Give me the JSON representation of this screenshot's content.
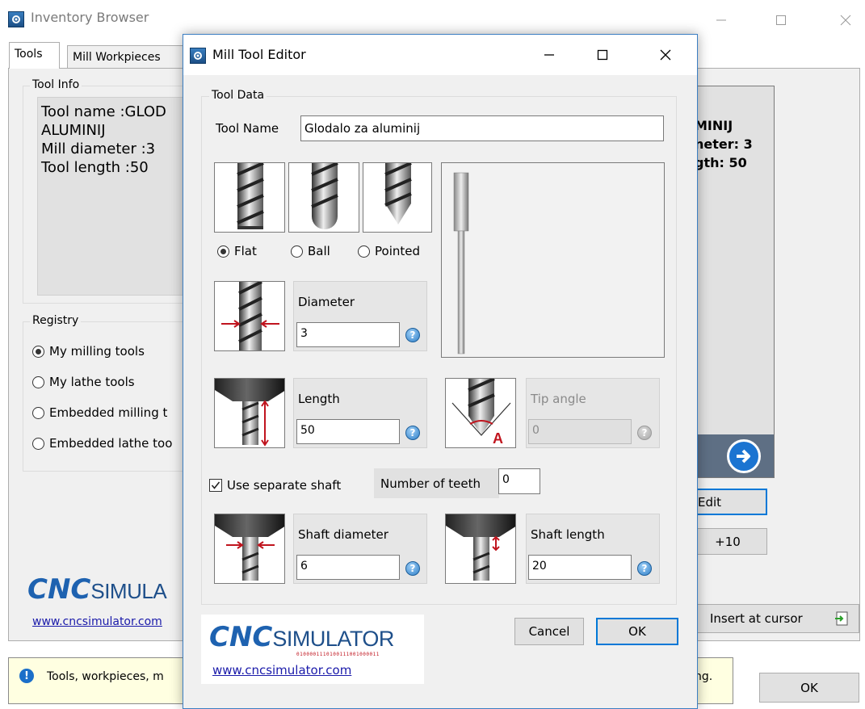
{
  "main_window": {
    "title": "Inventory Browser",
    "tabs": [
      "Tools",
      "Mill Workpieces"
    ],
    "tool_info": {
      "legend": "Tool Info",
      "lines": [
        "Tool name :GLOD",
        "ALUMINIJ",
        "Mill diameter :3",
        "Tool length :50"
      ]
    },
    "registry": {
      "legend": "Registry",
      "options": [
        {
          "label": "My milling tools",
          "selected": true
        },
        {
          "label": "My lathe tools",
          "selected": false
        },
        {
          "label": "Embedded milling t",
          "selected": false
        },
        {
          "label": "Embedded lathe too",
          "selected": false
        }
      ]
    },
    "preview_text": [
      "MINIJ",
      "neter: 3",
      "gth: 50"
    ],
    "edit_button": "Edit",
    "plus10_button": "+10",
    "insert_button": "Insert at cursor",
    "status_text": "Tools, workpieces, m",
    "status_text_right": "ng.",
    "ok_button": "OK",
    "logo": {
      "cnc": "CNC",
      "sim": "SIMULA",
      "url": "www.cncsimulator.com"
    }
  },
  "dialog": {
    "title": "Mill Tool Editor",
    "group_legend": "Tool Data",
    "tool_name_label": "Tool Name",
    "tool_name_value": "Glodalo za aluminij",
    "tip_types": [
      {
        "label": "Flat",
        "selected": true
      },
      {
        "label": "Ball",
        "selected": false
      },
      {
        "label": "Pointed",
        "selected": false
      }
    ],
    "diameter": {
      "label": "Diameter",
      "value": "3"
    },
    "length": {
      "label": "Length",
      "value": "50"
    },
    "tip_angle": {
      "label": "Tip angle",
      "value": "0"
    },
    "separate_shaft": {
      "label": "Use separate shaft",
      "checked": true
    },
    "teeth": {
      "label": "Number of teeth",
      "value": "0"
    },
    "shaft_diameter": {
      "label": "Shaft diameter",
      "value": "6"
    },
    "shaft_length": {
      "label": "Shaft length",
      "value": "20"
    },
    "help_symbol": "?",
    "cancel_button": "Cancel",
    "ok_button": "OK",
    "logo": {
      "cnc": "CNC",
      "sim": "SIMULATOR",
      "bits": "0100001110100111001000011",
      "url": "www.cncsimulator.com"
    }
  },
  "colors": {
    "accent": "#0078d7",
    "logo_blue": "#1e62b0",
    "status_bg": "#ffffe1"
  }
}
